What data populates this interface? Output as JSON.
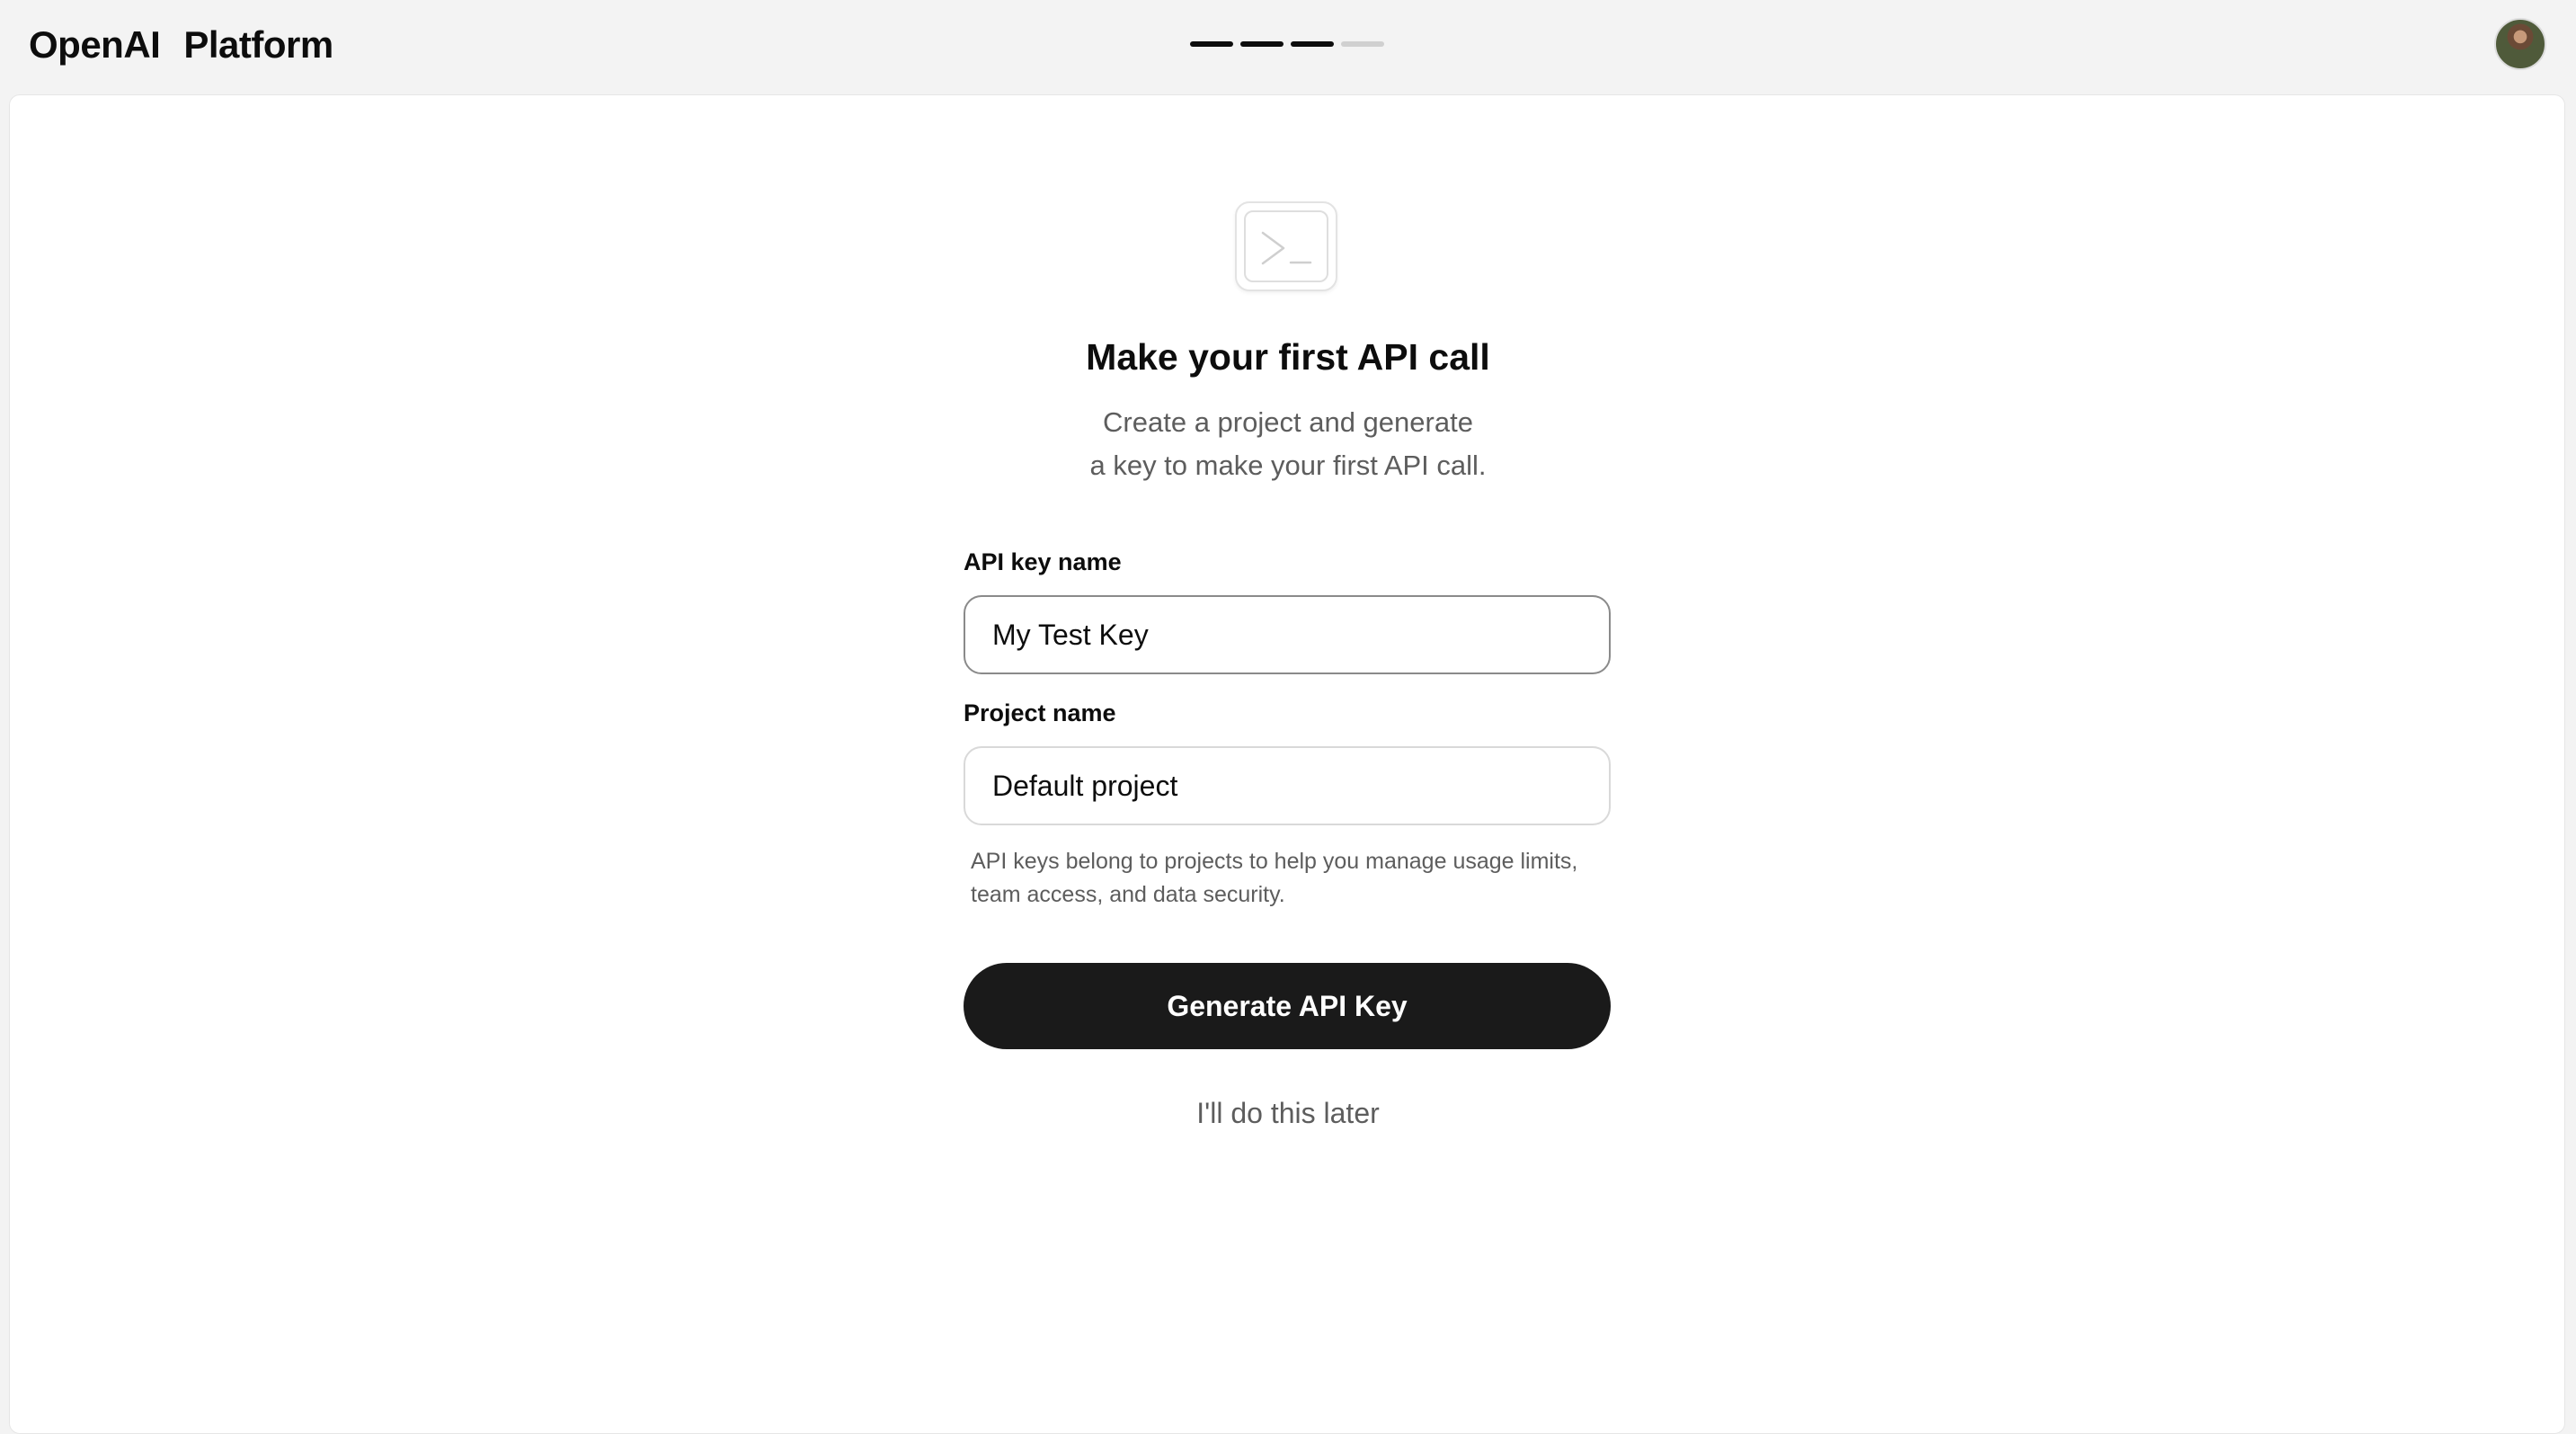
{
  "header": {
    "brand": "OpenAI",
    "product": "Platform",
    "progress_steps_completed": 3,
    "progress_steps_total": 4
  },
  "main": {
    "icon": "terminal-icon",
    "title": "Make your first API call",
    "subtitle_line1": "Create a project and generate",
    "subtitle_line2": "a key to make your first API call.",
    "api_key_label": "API key name",
    "api_key_value": "My Test Key",
    "project_label": "Project name",
    "project_value": "Default project",
    "help_line1": "API keys belong to projects to help you manage usage limits,",
    "help_line2": "team access, and data security.",
    "generate_button": "Generate API Key",
    "later_link": "I'll do this later"
  }
}
